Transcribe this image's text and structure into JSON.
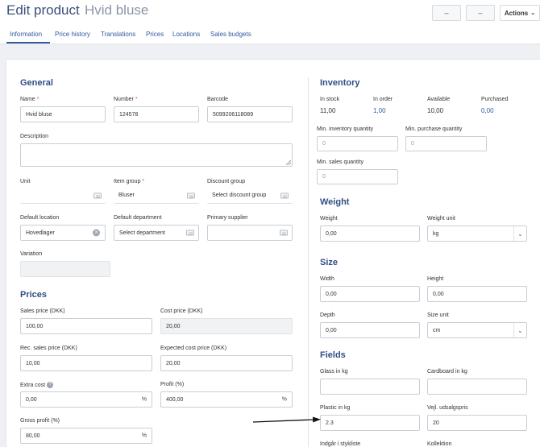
{
  "header": {
    "title": "Edit product",
    "product_name": "Hvid bluse",
    "btn1": "–",
    "btn2": "–",
    "actions": "Actions"
  },
  "tabs": [
    "Information",
    "Price history",
    "Translations",
    "Prices",
    "Locations",
    "Sales budgets"
  ],
  "general": {
    "title": "General",
    "name": {
      "label": "Name",
      "value": "Hvid bluse"
    },
    "number": {
      "label": "Number",
      "value": "124578"
    },
    "barcode": {
      "label": "Barcode",
      "value": "5099206118089"
    },
    "description": {
      "label": "Description",
      "value": ""
    },
    "unit": {
      "label": "Unit",
      "value": ""
    },
    "item_group": {
      "label": "Item group",
      "value": "Bluser"
    },
    "discount_group": {
      "label": "Discount group",
      "placeholder": "Select discount group"
    },
    "default_location": {
      "label": "Default location",
      "value": "Hovedlager"
    },
    "default_department": {
      "label": "Default department",
      "placeholder": "Select department"
    },
    "primary_supplier": {
      "label": "Primary supplier",
      "value": ""
    },
    "variation": {
      "label": "Variation",
      "value": ""
    },
    "required_mark": "*"
  },
  "prices": {
    "title": "Prices",
    "sales_price": {
      "label": "Sales price (DKK)",
      "value": "100,00"
    },
    "cost_price": {
      "label": "Cost price (DKK)",
      "value": "20,00"
    },
    "rec_sales_price": {
      "label": "Rec. sales price (DKK)",
      "value": "10,00"
    },
    "expected_cost_price": {
      "label": "Expected cost price (DKK)",
      "value": "20,00"
    },
    "extra_cost": {
      "label": "Extra cost",
      "value": "0,00",
      "unit": "%",
      "help": "?"
    },
    "profit": {
      "label": "Profit (%)",
      "value": "400,00",
      "unit": "%"
    },
    "gross_profit": {
      "label": "Gross profit (%)",
      "value": "80,00",
      "unit": "%"
    }
  },
  "inventory": {
    "title": "Inventory",
    "in_stock": {
      "label": "In stock",
      "value": "11,00"
    },
    "in_order": {
      "label": "In order",
      "value": "1,00"
    },
    "available": {
      "label": "Available",
      "value": "10,00"
    },
    "purchased": {
      "label": "Purchased",
      "value": "0,00"
    },
    "min_inventory": {
      "label": "Min. inventory quantity",
      "placeholder": "0"
    },
    "min_purchase": {
      "label": "Min. purchase quantity",
      "placeholder": "0"
    },
    "min_sales": {
      "label": "Min. sales quantity",
      "placeholder": "0"
    }
  },
  "weight": {
    "title": "Weight",
    "weight": {
      "label": "Weight",
      "value": "0,00"
    },
    "unit": {
      "label": "Weight unit",
      "value": "kg"
    }
  },
  "size": {
    "title": "Size",
    "width": {
      "label": "Width",
      "value": "0,00"
    },
    "height": {
      "label": "Height",
      "value": "0,00"
    },
    "depth": {
      "label": "Depth",
      "value": "0,00"
    },
    "unit": {
      "label": "Size unit",
      "value": "cm"
    }
  },
  "fields": {
    "title": "Fields",
    "glass": {
      "label": "Glass in kg",
      "value": ""
    },
    "cardboard": {
      "label": "Cardboard in kg",
      "value": ""
    },
    "plastic": {
      "label": "Plastic in kg",
      "value": "2.3"
    },
    "vejl": {
      "label": "Vejl. udsalgspris",
      "value": "20"
    },
    "indgaar": {
      "label": "Indgår i stykliste"
    },
    "kollektion": {
      "label": "Kollektion"
    }
  },
  "icons": {
    "chevron": "chevron-down-icon",
    "clear": "clear-icon",
    "lookup": "lookup-icon",
    "arrow": "annotation-arrow"
  }
}
